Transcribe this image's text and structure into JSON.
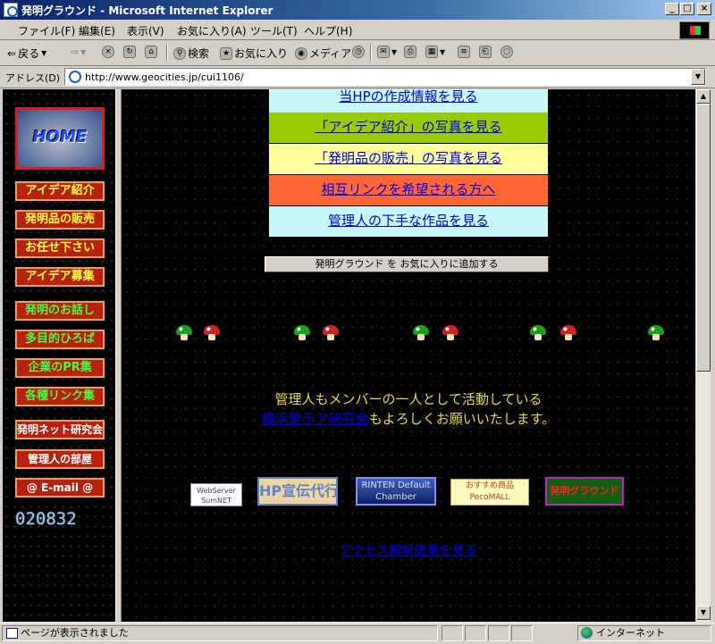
{
  "window": {
    "title": "発明グラウンド - Microsoft Internet Explorer"
  },
  "menu": [
    "ファイル(F)",
    "編集(E)",
    "表示(V)",
    "お気に入り(A)",
    "ツール(T)",
    "ヘルプ(H)"
  ],
  "toolbar": {
    "back": "戻る",
    "search": "検索",
    "favorites": "お気に入り",
    "media": "メディア"
  },
  "address": {
    "label": "アドレス(D)",
    "url": "http://www.geocities.jp/cui1106/"
  },
  "left_nav": {
    "home": "HOME",
    "items": [
      "アイデア紹介",
      "発明品の販売",
      "お任せ下さい",
      "アイデア募集",
      "発明のお話し",
      "多目的ひろば",
      "企業のPR集",
      "各種リンク集",
      "発明ネット研究会",
      "管理人の部屋",
      "@ E-mail @"
    ],
    "counter": "020832"
  },
  "main": {
    "links": [
      "当HPの作成情報を見る",
      "「アイデア紹介」の写真を見る",
      "「発明品の販売」の写真を見る",
      "相互リンクを希望される方へ",
      "管理人の下手な作品を見る"
    ],
    "favorite_button": "発明グラウンド を お気に入りに追加する",
    "message1": "管理人もメンバーの一人として活動している",
    "message2_link": "横浜愛テア研究会",
    "message2_rest": "もよろしくお願いいたします。",
    "banners": [
      "WebServer SumNET",
      "HP宣伝代行",
      "RINTEN Default Chamber",
      "おすすめ商品 PecoMALL",
      "発明グラウンド"
    ],
    "analysis_link": "アクセス解析結果を見る"
  },
  "status": {
    "text": "ページが表示されました",
    "zone": "インターネット"
  },
  "colors": {
    "link_bg": [
      "#c8f8f8",
      "#99cc00",
      "#ffff99",
      "#ff6633",
      "#c8f8f8"
    ],
    "nav_bg": "#b82010"
  }
}
